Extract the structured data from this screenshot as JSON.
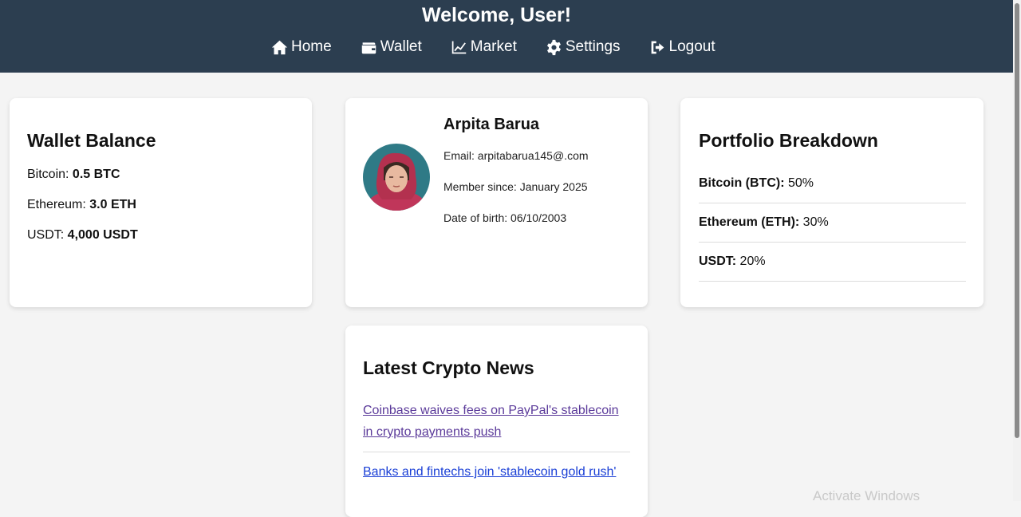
{
  "header": {
    "title": "Welcome, User!",
    "nav": [
      {
        "label": "Home",
        "icon": "home-icon"
      },
      {
        "label": "Wallet",
        "icon": "wallet-icon"
      },
      {
        "label": "Market",
        "icon": "chart-line-icon"
      },
      {
        "label": "Settings",
        "icon": "gear-icon"
      },
      {
        "label": "Logout",
        "icon": "logout-icon"
      }
    ]
  },
  "wallet": {
    "title": "Wallet Balance",
    "rows": [
      {
        "label": "Bitcoin: ",
        "value": "0.5 BTC"
      },
      {
        "label": "Ethereum: ",
        "value": "3.0 ETH"
      },
      {
        "label": "USDT: ",
        "value": "4,000 USDT"
      }
    ]
  },
  "profile": {
    "name": "Arpita Barua",
    "email": "Email: arpitabarua145@.com",
    "member_since": "Member since: January 2025",
    "dob": "Date of birth: 06/10/2003"
  },
  "portfolio": {
    "title": "Portfolio Breakdown",
    "rows": [
      {
        "label": "Bitcoin (BTC):",
        "value": " 50%"
      },
      {
        "label": "Ethereum (ETH):",
        "value": " 30%"
      },
      {
        "label": "USDT:",
        "value": " 20%"
      }
    ]
  },
  "news": {
    "title": "Latest Crypto News",
    "items": [
      "Coinbase waives fees on PayPal's stablecoin in crypto payments push",
      "Banks and fintechs join 'stablecoin gold rush'"
    ]
  },
  "watermark": "Activate Windows",
  "colors": {
    "header_bg": "#2c3e50",
    "visited_link": "#5b3a9a",
    "link": "#1a3fd6"
  }
}
